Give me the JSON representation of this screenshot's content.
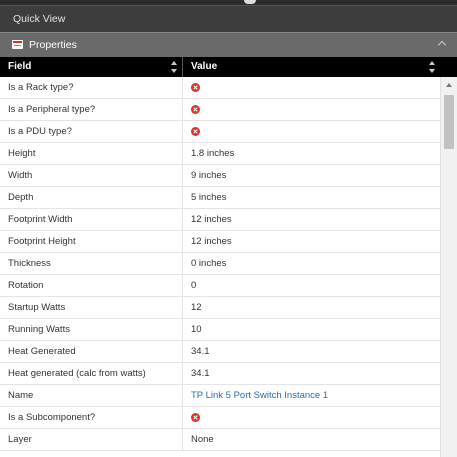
{
  "quick_view": {
    "title": "Quick View"
  },
  "properties": {
    "title": "Properties",
    "icon": "properties-panel-icon",
    "collapse_icon": "chevron-up-icon"
  },
  "table": {
    "columns": [
      "Field",
      "Value"
    ],
    "rows": [
      {
        "field": "Is a Rack type?",
        "value": "",
        "value_icon": "false-x-icon"
      },
      {
        "field": "Is a Peripheral type?",
        "value": "",
        "value_icon": "false-x-icon"
      },
      {
        "field": "Is a PDU type?",
        "value": "",
        "value_icon": "false-x-icon"
      },
      {
        "field": "Height",
        "value": "1.8 inches"
      },
      {
        "field": "Width",
        "value": "9 inches"
      },
      {
        "field": "Depth",
        "value": "5 inches"
      },
      {
        "field": "Footprint Width",
        "value": "12 inches"
      },
      {
        "field": "Footprint Height",
        "value": "12 inches"
      },
      {
        "field": "Thickness",
        "value": "0 inches"
      },
      {
        "field": "Rotation",
        "value": "0"
      },
      {
        "field": "Startup Watts",
        "value": "12"
      },
      {
        "field": "Running Watts",
        "value": "10"
      },
      {
        "field": "Heat Generated",
        "value": "34.1"
      },
      {
        "field": "Heat generated (calc from watts)",
        "value": "34.1"
      },
      {
        "field": "Name",
        "value": "TP Link 5 Port Switch Instance 1",
        "link": true
      },
      {
        "field": "Is a Subcomponent?",
        "value": "",
        "value_icon": "false-x-icon"
      },
      {
        "field": "Layer",
        "value": "None"
      }
    ]
  },
  "colors": {
    "link": "#2a6db0",
    "false_icon": "#d9362b",
    "header_bg": "#000000"
  }
}
